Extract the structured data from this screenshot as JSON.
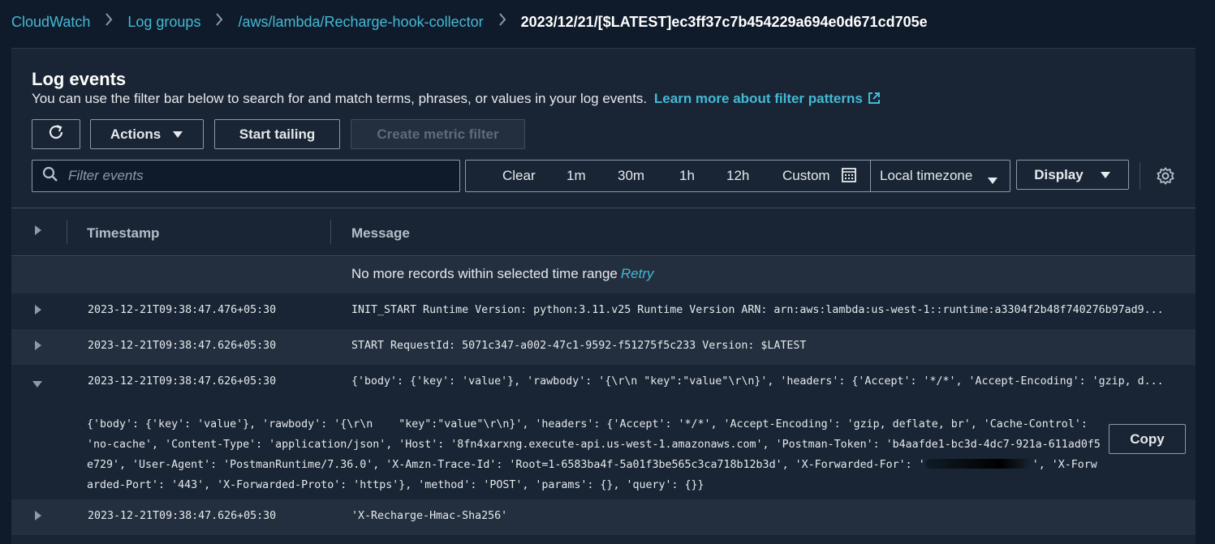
{
  "breadcrumb": {
    "items": [
      "CloudWatch",
      "Log groups",
      "/aws/lambda/Recharge-hook-collector"
    ],
    "current": "2023/12/21/[$LATEST]ec3ff37c7b454229a694e0d671cd705e"
  },
  "panel": {
    "title": "Log events",
    "description": "You can use the filter bar below to search for and match terms, phrases, or values in your log events.",
    "learn_link": "Learn more about filter patterns"
  },
  "toolbar": {
    "actions_label": "Actions",
    "tailing_label": "Start tailing",
    "metric_label": "Create metric filter"
  },
  "filter": {
    "placeholder": "Filter events"
  },
  "range": {
    "clear": "Clear",
    "m1": "1m",
    "m30": "30m",
    "h1": "1h",
    "h12": "12h",
    "custom": "Custom",
    "timezone": "Local timezone"
  },
  "display_label": "Display",
  "table": {
    "col_timestamp": "Timestamp",
    "col_message": "Message",
    "no_more": "No more records within selected time range",
    "retry": "Retry",
    "rows": [
      {
        "ts": "2023-12-21T09:38:47.476+05:30",
        "msg": "INIT_START Runtime Version: python:3.11.v25 Runtime Version ARN: arn:aws:lambda:us-west-1::runtime:a3304f2b48f740276b97ad9..."
      },
      {
        "ts": "2023-12-21T09:38:47.626+05:30",
        "msg": "START RequestId: 5071c347-a002-47c1-9592-f51275f5c233 Version: $LATEST"
      },
      {
        "ts": "2023-12-21T09:38:47.626+05:30",
        "msg": "{'body': {'key': 'value'}, 'rawbody': '{\\r\\n \"key\":\"value\"\\r\\n}', 'headers': {'Accept': '*/*', 'Accept-Encoding': 'gzip, d..."
      },
      {
        "ts": "2023-12-21T09:38:47.626+05:30",
        "msg": "'X-Recharge-Hmac-Sha256'"
      }
    ],
    "expanded_body_a": "{'body': {'key': 'value'}, 'rawbody': '{\\r\\n    \"key\":\"value\"\\r\\n}', 'headers': {'Accept': '*/*', 'Accept-Encoding': 'gzip, deflate, br', 'Cache-Control': 'no-cache', 'Content-Type': 'application/json', 'Host': '8fn4xarxng.execute-api.us-west-1.amazonaws.com', 'Postman-Token': 'b4aafde1-bc3d-4dc7-921a-611ad0f5e729', 'User-Agent': 'PostmanRuntime/7.36.0', 'X-Amzn-Trace-Id': 'Root=1-6583ba4f-5a01f3be565c3ca718b12b3d', 'X-Forwarded-For': '",
    "expanded_body_b": "', 'X-Forwarded-Port': '443', 'X-Forwarded-Proto': 'https'}, 'method': 'POST', 'params': {}, 'query': {}}",
    "copy_label": "Copy"
  },
  "colors": {
    "link": "#44b9d6",
    "background": "#0f1b2a",
    "panel": "#192534"
  }
}
